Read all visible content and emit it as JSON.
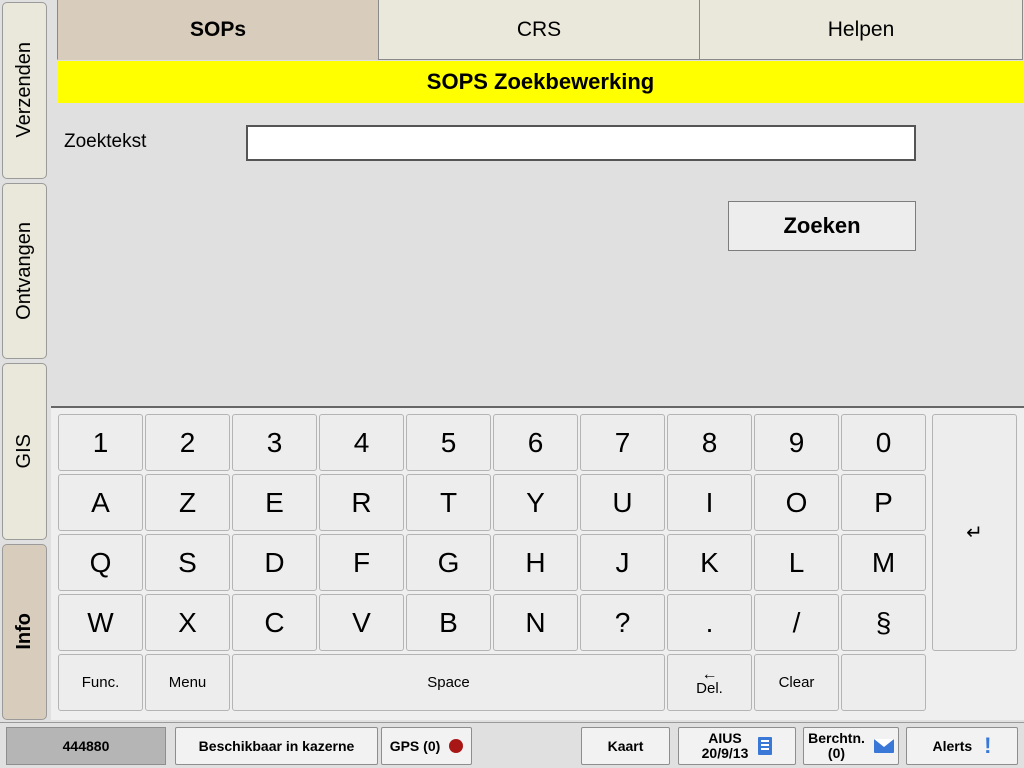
{
  "sidebar": {
    "items": [
      {
        "label": "Verzenden",
        "selected": false
      },
      {
        "label": "Ontvangen",
        "selected": false
      },
      {
        "label": "GIS",
        "selected": false
      },
      {
        "label": "Info",
        "selected": true
      }
    ]
  },
  "tabs": [
    {
      "label": "SOPs",
      "selected": true
    },
    {
      "label": "CRS",
      "selected": false
    },
    {
      "label": "Helpen",
      "selected": false
    }
  ],
  "banner": {
    "title": "SOPS Zoekbewerking",
    "background": "#ffff00"
  },
  "search": {
    "label": "Zoektekst",
    "value": "",
    "placeholder": "",
    "button_label": "Zoeken"
  },
  "keyboard": {
    "rows": [
      [
        "1",
        "2",
        "3",
        "4",
        "5",
        "6",
        "7",
        "8",
        "9",
        "0"
      ],
      [
        "A",
        "Z",
        "E",
        "R",
        "T",
        "Y",
        "U",
        "I",
        "O",
        "P"
      ],
      [
        "Q",
        "S",
        "D",
        "F",
        "G",
        "H",
        "J",
        "K",
        "L",
        "M"
      ],
      [
        "W",
        "X",
        "C",
        "V",
        "B",
        "N",
        "?",
        ".",
        "/",
        "§"
      ]
    ],
    "bottom_row": {
      "func_label": "Func.",
      "menu_label": "Menu",
      "space_label": "Space",
      "del_arrow": "←",
      "del_label": "Del.",
      "clear_label": "Clear",
      "blank_label": ""
    },
    "enter_label": "↵"
  },
  "statusbar": {
    "unit_id": "444880",
    "status_label": "Beschikbaar in kazerne",
    "gps_label": "GPS (0)",
    "gps_indicator_color": "#a81616",
    "map_label": "Kaart",
    "aius_line1": "AIUS",
    "aius_line2": "20/9/13",
    "messages_line1": "Berchtn.",
    "messages_line2": "(0)",
    "alerts_label": "Alerts",
    "alerts_icon_glyph": "!",
    "accent_blue": "#3a78d8"
  }
}
